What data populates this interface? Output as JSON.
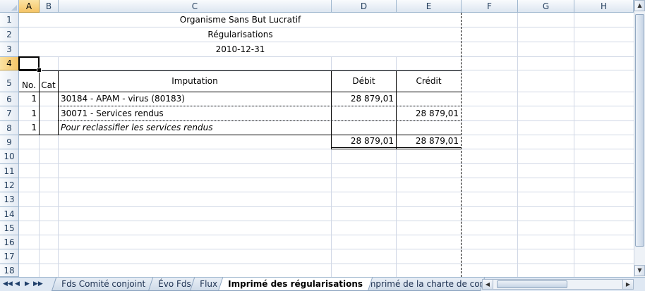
{
  "columns": [
    "A",
    "B",
    "C",
    "D",
    "E",
    "F",
    "G",
    "H"
  ],
  "rows": [
    "1",
    "2",
    "3",
    "4",
    "5",
    "6",
    "7",
    "8",
    "9",
    "10",
    "11",
    "12",
    "13",
    "14",
    "15",
    "16",
    "17",
    "18"
  ],
  "selection": {
    "column": "A",
    "row": "4"
  },
  "sheet": {
    "org": "Organisme Sans But Lucratif",
    "title": "Régularisations",
    "date": "2010-12-31",
    "header": {
      "no": "No.",
      "cat": "Cat",
      "imputation": "Imputation",
      "debit": "Débit",
      "credit": "Crédit"
    },
    "lines": [
      {
        "no": "1",
        "cat": "",
        "imputation": "30184 - APAM - virus (80183)",
        "debit": "28 879,01",
        "credit": ""
      },
      {
        "no": "1",
        "cat": "",
        "imputation": "30071 - Services rendus",
        "debit": "",
        "credit": "28 879,01"
      },
      {
        "no": "1",
        "cat": "",
        "imputation": "Pour reclassifier les services rendus",
        "debit": "",
        "credit": ""
      }
    ],
    "totals": {
      "debit": "28 879,01",
      "credit": "28 879,01"
    }
  },
  "tabs": [
    {
      "label": "Fds Comité conjoint",
      "active": false
    },
    {
      "label": "Évo Fds",
      "active": false
    },
    {
      "label": "Flux",
      "active": false
    },
    {
      "label": "Imprimé des régularisations",
      "active": true
    },
    {
      "label": "Imprimé de la charte de comp",
      "active": false
    }
  ],
  "nav": {
    "first": "◀◀",
    "prev": "◀",
    "next": "▶",
    "last": "▶▶"
  }
}
